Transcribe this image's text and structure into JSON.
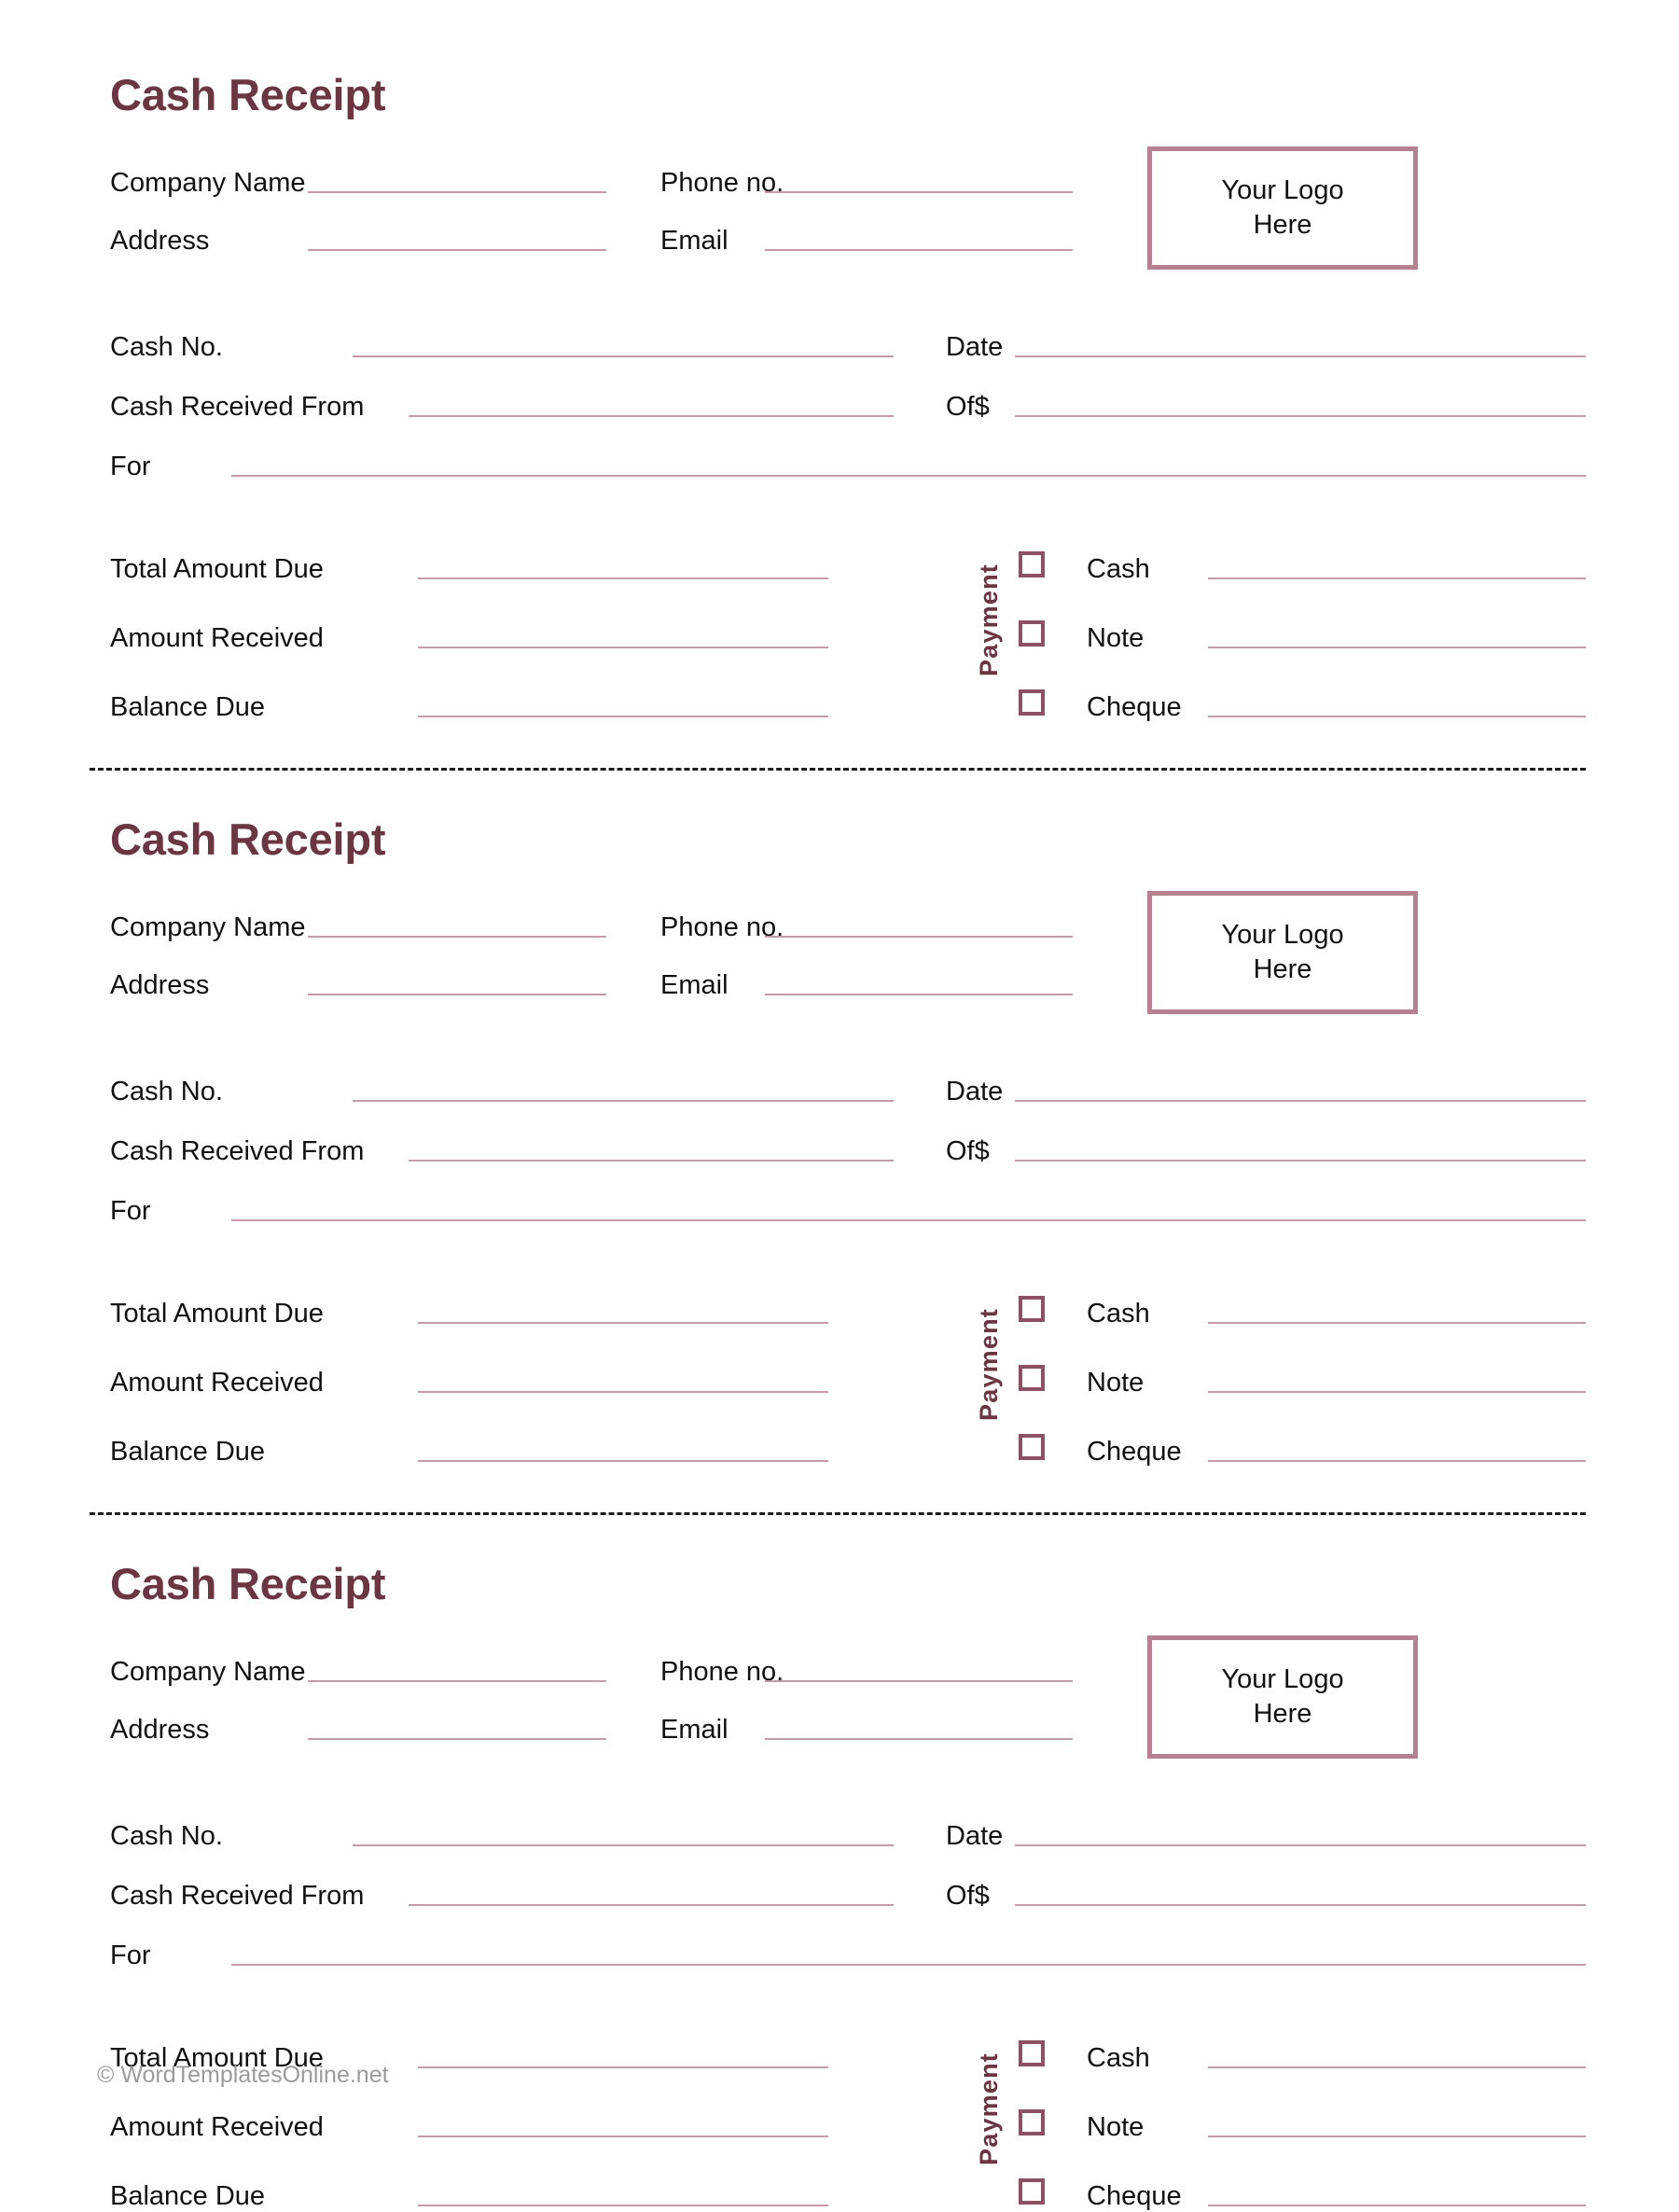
{
  "document": {
    "title": "Cash Receipt",
    "footer": "© WordTemplatesOnline.net",
    "colors": {
      "title": "#6B3542",
      "rule": "#C49BA8",
      "logo_border": "#B5808F",
      "checkbox": "#8C5263",
      "footer_text": "#9b9b9b"
    }
  },
  "labels": {
    "company_name": "Company Name",
    "address": "Address",
    "phone_no": "Phone no.",
    "email": "Email",
    "cash_no": "Cash No.",
    "date": "Date",
    "cash_received_from": "Cash Received From",
    "of_amount": "Of$",
    "for": "For",
    "total_amount_due": "Total Amount Due",
    "amount_received": "Amount Received",
    "balance_due": "Balance Due",
    "payment": "Payment",
    "cash": "Cash",
    "note": "Note",
    "cheque": "Cheque"
  },
  "logo_box": {
    "line1": "Your Logo",
    "line2": "Here"
  },
  "values": {
    "company_name": "",
    "address": "",
    "phone_no": "",
    "email": "",
    "cash_no": "",
    "date": "",
    "cash_received_from": "",
    "of_amount": "",
    "for": "",
    "total_amount_due": "",
    "amount_received": "",
    "balance_due": "",
    "cash": "",
    "note": "",
    "cheque": ""
  },
  "receipts": [
    {
      "index": 1
    },
    {
      "index": 2
    },
    {
      "index": 3
    }
  ]
}
